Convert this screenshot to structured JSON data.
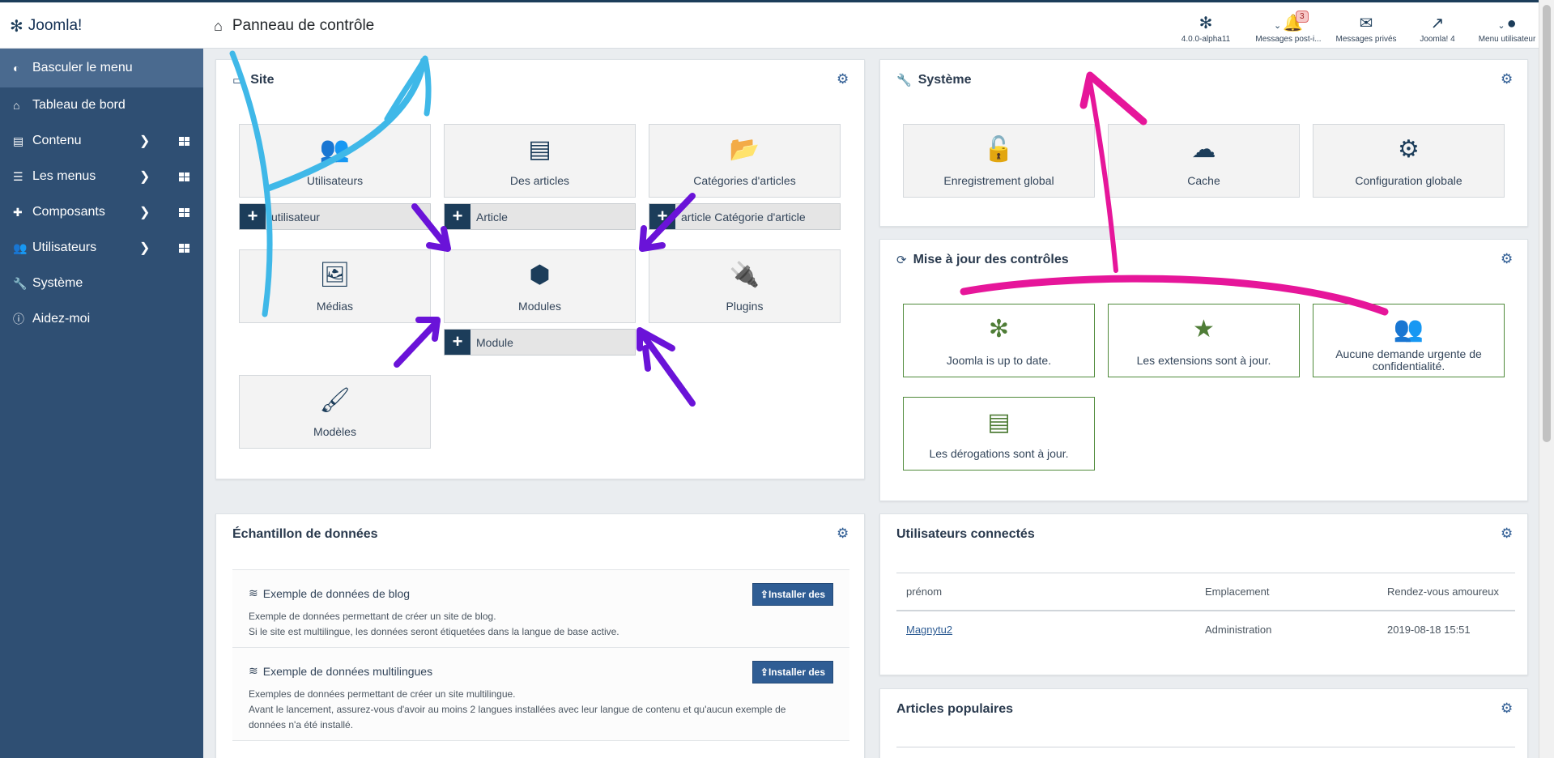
{
  "header": {
    "logo_text": "Joomla!",
    "page_title": "Panneau de contrôle",
    "items": [
      {
        "label": "4.0.0-alpha11",
        "icon": "joomla-icon"
      },
      {
        "label": "Messages post-i...",
        "icon": "bell-icon",
        "badge": "3"
      },
      {
        "label": "Messages privés",
        "icon": "envelope-icon"
      },
      {
        "label": "Joomla! 4",
        "icon": "external-link-icon"
      },
      {
        "label": "Menu utilisateur",
        "icon": "user-circle-icon"
      }
    ]
  },
  "sidebar": {
    "items": [
      {
        "label": "Basculer le menu",
        "icon": "toggle-icon"
      },
      {
        "label": "Tableau de bord",
        "icon": "home-icon"
      },
      {
        "label": "Contenu",
        "icon": "file-icon"
      },
      {
        "label": "Les menus",
        "icon": "list-icon"
      },
      {
        "label": "Composants",
        "icon": "puzzle-icon"
      },
      {
        "label": "Utilisateurs",
        "icon": "users-icon"
      },
      {
        "label": "Système",
        "icon": "wrench-icon"
      },
      {
        "label": "Aidez-moi",
        "icon": "info-icon"
      }
    ]
  },
  "site": {
    "title": "Site",
    "tiles": [
      "Utilisateurs",
      "Des articles",
      "Catégories d'articles",
      "Médias",
      "Modules",
      "Plugins",
      "Modèles"
    ],
    "add": [
      "utilisateur",
      "Article",
      "article Catégorie d'article",
      "Module"
    ]
  },
  "systeme": {
    "title": "Système",
    "tiles": [
      "Enregistrement global",
      "Cache",
      "Configuration globale"
    ]
  },
  "maj": {
    "title": "Mise à jour des contrôles",
    "tiles": [
      "Joomla is up to date.",
      "Les extensions sont à jour.",
      "Aucune demande urgente de confidentialité.",
      "Les dérogations sont à jour."
    ]
  },
  "sample": {
    "title": "Échantillon de données",
    "rows": [
      {
        "title": "Exemple de données de blog",
        "desc": "Exemple de données permettant de créer un site de blog.",
        "desc2": "Si le site est multilingue, les données seront étiquetées dans la langue de base active.",
        "button": "Installer des"
      },
      {
        "title": "Exemple de données multilingues",
        "desc": "Exemples de données permettant de créer un site multilingue.",
        "desc2": "Avant le lancement, assurez-vous d'avoir au moins 2 langues installées avec leur langue de contenu et qu'aucun exemple de données n'a été installé.",
        "button": "Installer des"
      }
    ]
  },
  "users": {
    "title": "Utilisateurs connectés",
    "headers": [
      "prénom",
      "Emplacement",
      "Rendez-vous amoureux"
    ],
    "rows": [
      {
        "name": "Magnytu2",
        "location": "Administration",
        "date": "2019-08-18 15:51"
      }
    ]
  },
  "popular": {
    "title": "Articles populaires"
  },
  "colors": {
    "sidebar": "#2f4f73",
    "header_dark": "#1c3d5a",
    "green": "#4f7d37",
    "annotation_cyan": "#3fb8e8",
    "annotation_pink": "#e6169a",
    "annotation_purple": "#6a13d8"
  }
}
